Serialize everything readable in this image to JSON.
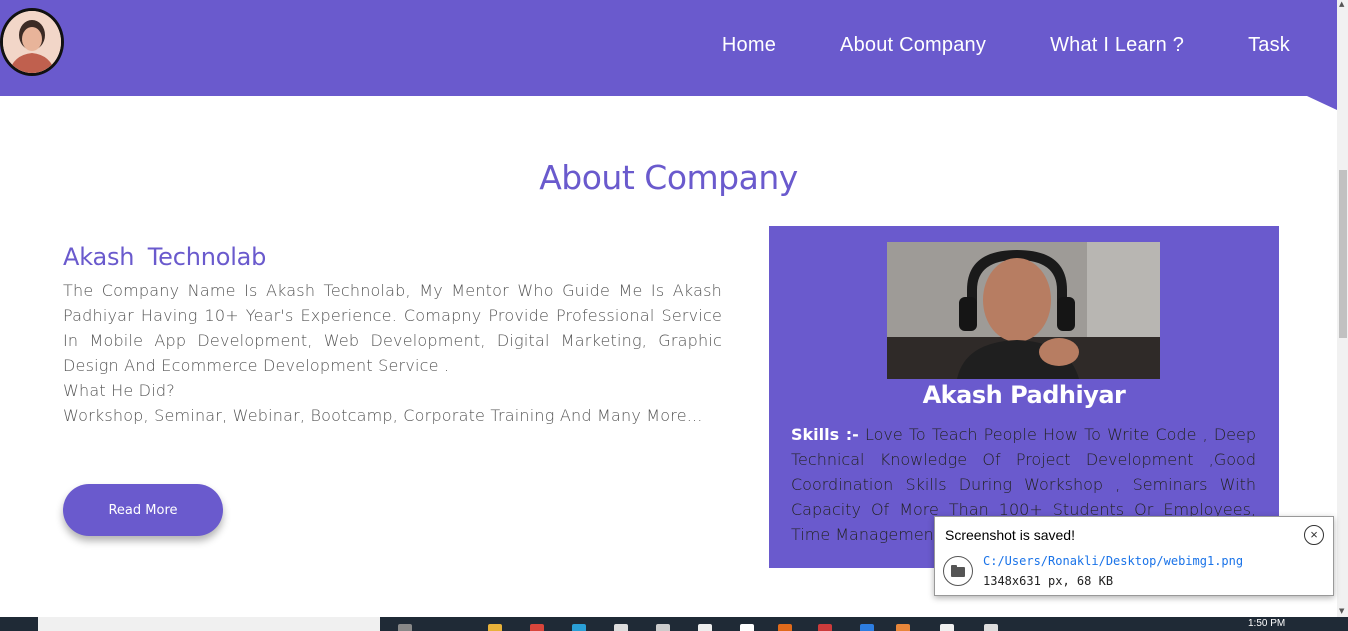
{
  "nav": {
    "links": [
      "Home",
      "About Company",
      "What I Learn ?",
      "Task"
    ]
  },
  "about": {
    "title": "About Company",
    "company_name": "Akash  Technolab",
    "paragraphs": [
      "The Company Name Is Akash Technolab, My Mentor Who Guide Me Is Akash Padhiyar Having 10+ Year's Experience. Comapny Provide Professional Service In Mobile App Development, Web Development, Digital Marketing, Graphic Design And Ecommerce Development Service .",
      "What He Did?",
      "Workshop, Seminar, Webinar, Bootcamp, Corporate Training And Many More..."
    ],
    "read_more_label": "Read More"
  },
  "profile": {
    "name": "Akash Padhiyar",
    "skills_label": "Skills :-",
    "skills_text": " Love To Teach People How To Write Code , Deep Technical Knowledge Of Project Development ,Good Coordination Skills During Workshop , Seminars With Capacity Of More Than 100+ Students Or Employees, Time Management ,Upo"
  },
  "toast": {
    "title": "Screenshot is saved!",
    "path": "C:/Users/Ronakli/Desktop/webimg1.png",
    "info": "1348x631 px, 68 KB"
  },
  "taskbar": {
    "clock": "1:50 PM"
  },
  "colors": {
    "accent": "#6a5acd"
  }
}
